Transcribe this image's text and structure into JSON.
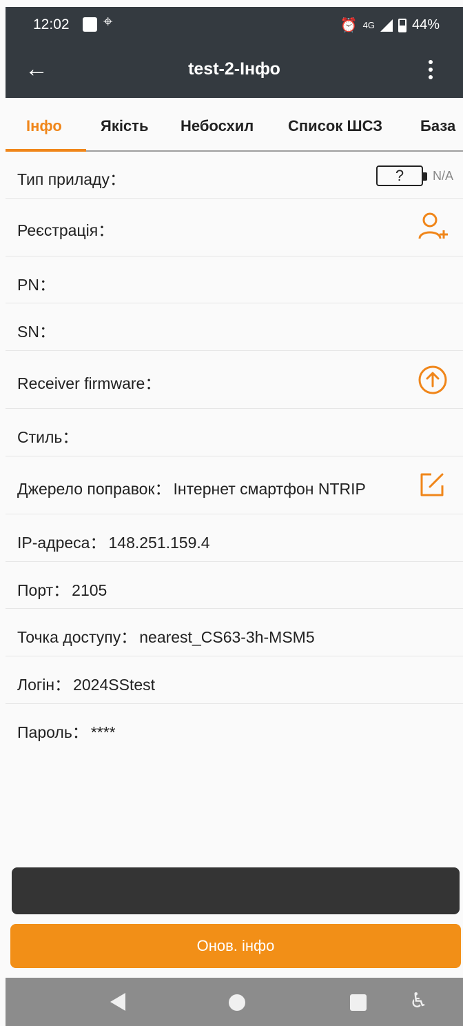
{
  "status_bar": {
    "time": "12:02",
    "network": "4G",
    "battery": "44%",
    "icons": [
      "square-notification-icon",
      "location-icon",
      "alarm-icon",
      "signal-icon",
      "battery-icon"
    ]
  },
  "app_bar": {
    "title": "test-2-Інфо"
  },
  "tabs": [
    {
      "label": "Інфо",
      "active": true
    },
    {
      "label": "Якість",
      "active": false
    },
    {
      "label": "Небосхил",
      "active": false
    },
    {
      "label": "Список ШСЗ",
      "active": false
    },
    {
      "label": "База",
      "active": false
    }
  ],
  "rows": {
    "device_type": {
      "label": "Тип приладу：",
      "battery_symbol": "?",
      "value": "N/A"
    },
    "registration": {
      "label": "Реєстрація："
    },
    "pn": {
      "label": "PN："
    },
    "sn": {
      "label": "SN："
    },
    "firmware": {
      "label": "Receiver firmware："
    },
    "style": {
      "label": "Стиль："
    },
    "correction_source": {
      "label": "Джерело поправок：",
      "value": "Інтернет смартфон NTRIP"
    },
    "ip": {
      "label": "IP-адреса：",
      "value": "148.251.159.4"
    },
    "port": {
      "label": "Порт：",
      "value": "2105"
    },
    "mountpoint": {
      "label": "Точка доступу：",
      "value": "nearest_CS63-3h-MSM5"
    },
    "login": {
      "label": "Логін：",
      "value": "2024SStest"
    },
    "password": {
      "label": "Пароль：",
      "value": "****"
    }
  },
  "buttons": {
    "update": "Онов. інфо"
  },
  "colors": {
    "accent": "#f0861a",
    "appbar": "#343a40",
    "button": "#f28f17"
  }
}
